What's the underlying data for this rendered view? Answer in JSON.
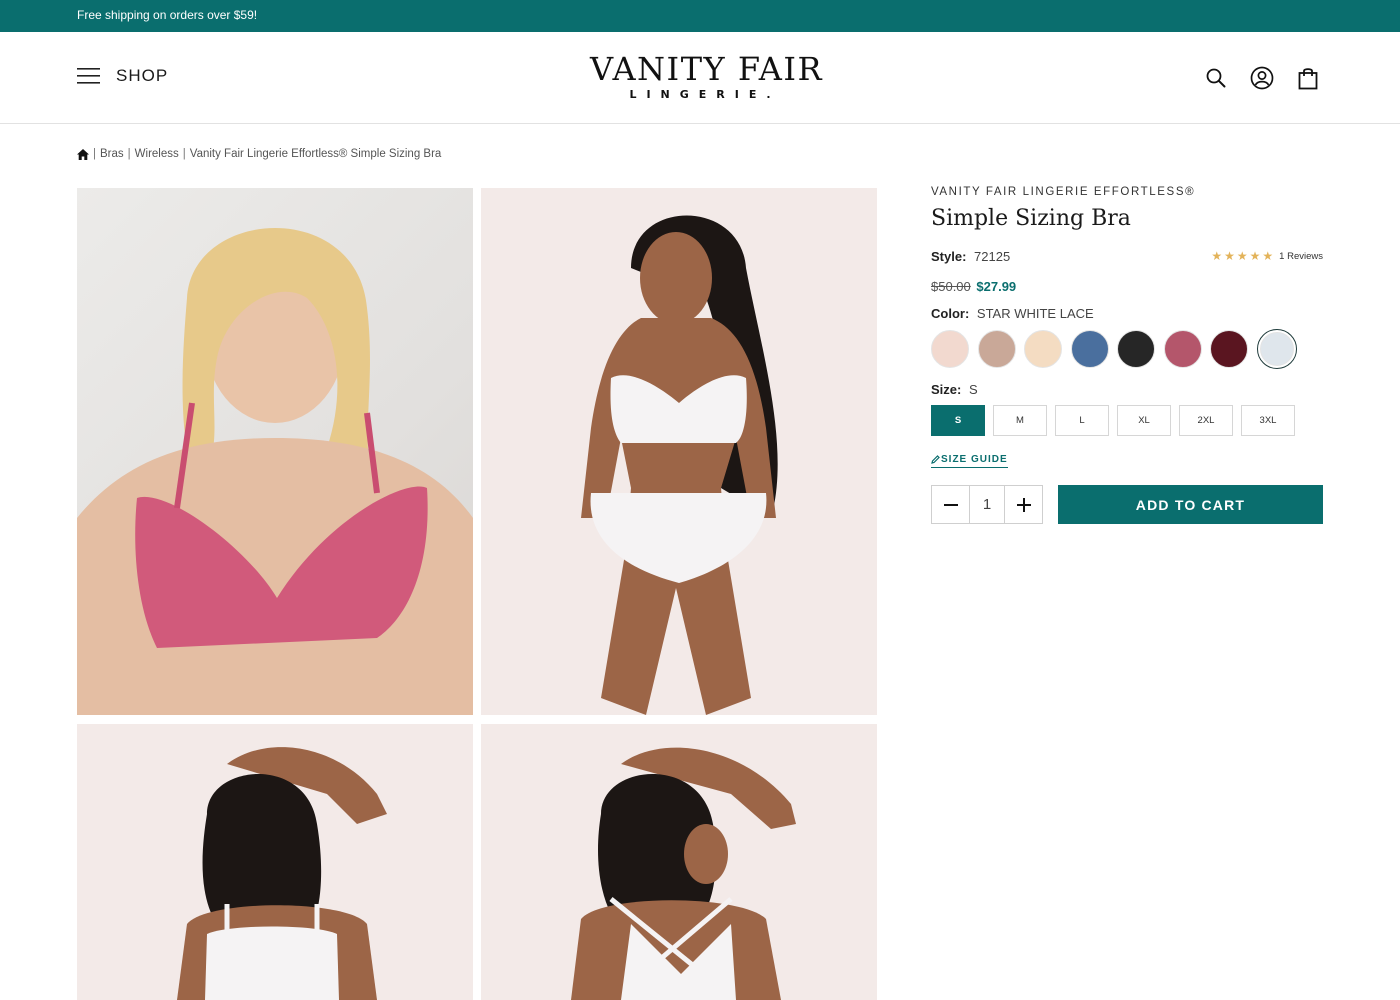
{
  "promo": {
    "text": "Free shipping on orders over $59!"
  },
  "header": {
    "shop_label": "SHOP",
    "logo_main": "VANITY FAIR",
    "logo_sub": "LINGERIE."
  },
  "breadcrumb": {
    "items": [
      "Bras",
      "Wireless",
      "Vanity Fair Lingerie Effortless® Simple Sizing Bra"
    ],
    "separator": "|"
  },
  "product": {
    "brand": "VANITY FAIR LINGERIE EFFORTLESS®",
    "title": "Simple Sizing Bra",
    "style_label": "Style:",
    "style_value": "72125",
    "rating_stars": 5,
    "reviews_text": "1 Reviews",
    "price_old": "$50.00",
    "price_new": "$27.99",
    "color_label": "Color:",
    "color_value": "STAR WHITE LACE",
    "swatches": [
      {
        "color": "#f2d9cf"
      },
      {
        "color": "#c9a898"
      },
      {
        "color": "#f4dcc2"
      },
      {
        "color": "#4a6f9e"
      },
      {
        "color": "#262626"
      },
      {
        "color": "#b4566b"
      },
      {
        "color": "#5a1520"
      },
      {
        "color": "#dfe6ec",
        "selected": true
      }
    ],
    "size_label": "Size:",
    "size_value": "S",
    "sizes": [
      "S",
      "M",
      "L",
      "XL",
      "2XL",
      "3XL"
    ],
    "active_size": "S",
    "size_guide": "SIZE GUIDE",
    "quantity": "1",
    "add_to_cart": "ADD TO CART"
  },
  "colors": {
    "accent": "#0a6e6e",
    "star": "#e3b35a"
  }
}
